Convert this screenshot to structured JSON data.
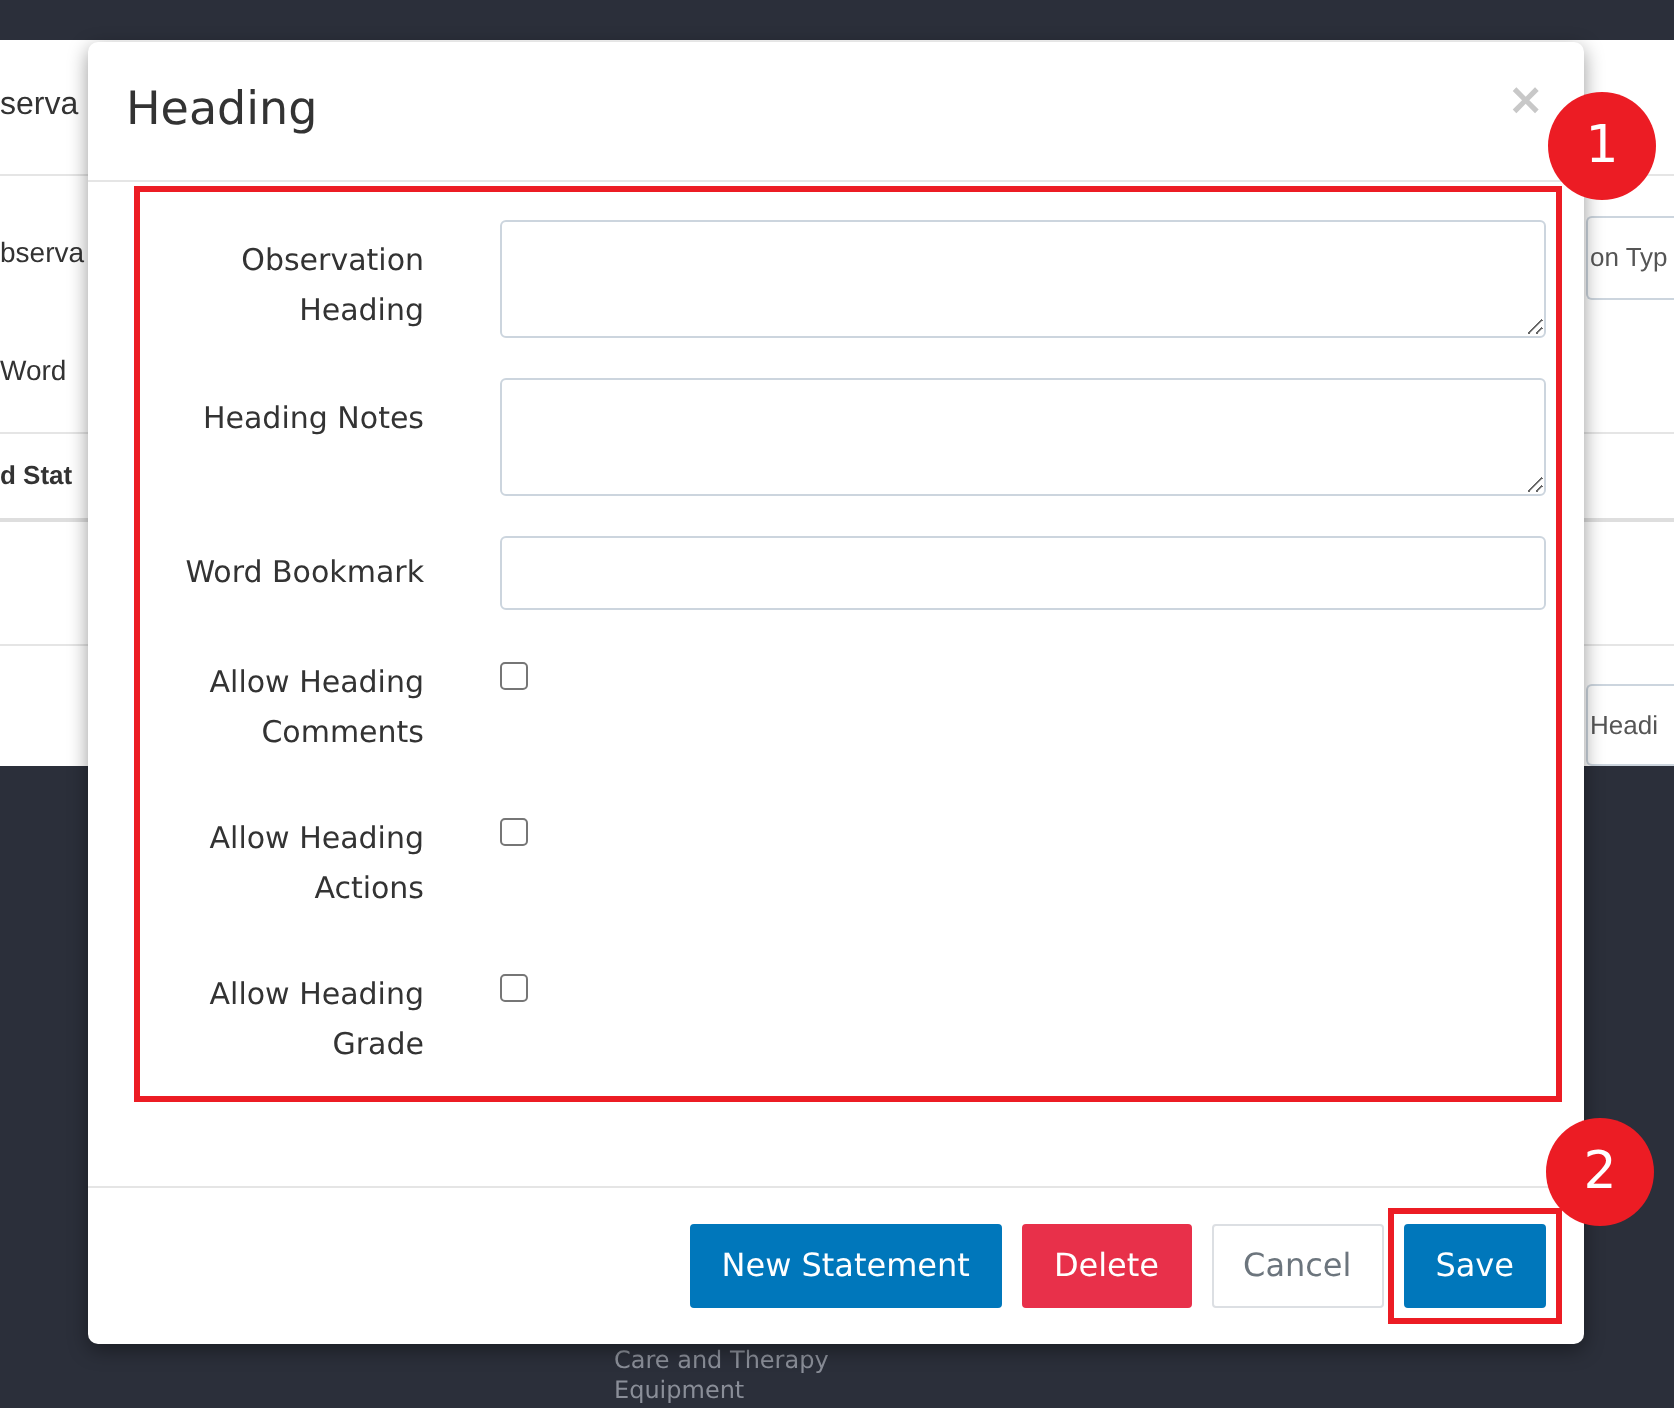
{
  "background": {
    "title": "serva",
    "fields": [
      {
        "label": "bserva"
      },
      {
        "label": "Word"
      }
    ],
    "type_input": {
      "placeholder": "on Typ"
    },
    "table_header": "d Stat",
    "button": "Headi",
    "footer_lines": [
      "Care and Therapy",
      "Equipment"
    ]
  },
  "modal": {
    "title": "Heading",
    "close": "×",
    "fields": [
      {
        "kind": "textarea",
        "label": "Observation Heading"
      },
      {
        "kind": "textarea",
        "label": "Heading Notes"
      },
      {
        "kind": "input",
        "label": "Word Bookmark"
      },
      {
        "kind": "checkbox",
        "label": "Allow Heading Comments",
        "checked": false
      },
      {
        "kind": "checkbox",
        "label": "Allow Heading Actions",
        "checked": false
      },
      {
        "kind": "checkbox",
        "label": "Allow Heading Grade",
        "checked": false
      }
    ],
    "buttons": [
      {
        "label": "New Statement",
        "kind": "primary",
        "highlighted": false
      },
      {
        "label": "Delete",
        "kind": "danger",
        "highlighted": false
      },
      {
        "label": "Cancel",
        "kind": "default",
        "highlighted": false
      },
      {
        "label": "Save",
        "kind": "primary",
        "highlighted": true
      }
    ]
  },
  "annotations": [
    "1",
    "2"
  ]
}
